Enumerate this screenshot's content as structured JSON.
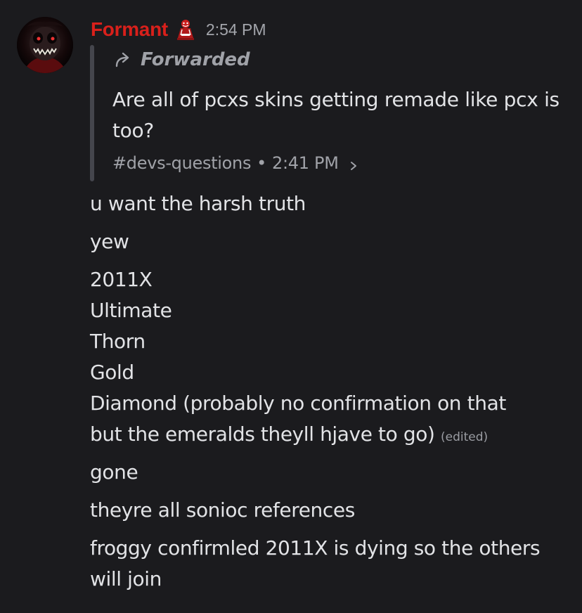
{
  "message": {
    "author": "Formant",
    "timestamp": "2:54 PM",
    "forwarded": {
      "label": "Forwarded",
      "text": "Are all of pcxs skins getting remade like pcx is too?",
      "channel": "#devs-questions",
      "separator": "•",
      "time": "2:41 PM"
    }
  },
  "messages": [
    "u want the harsh truth",
    "yew",
    "2011X",
    "Ultimate",
    "Thorn",
    "Gold",
    "Diamond (probably no confirmation on that",
    "but the emeralds theyll hjave to go)",
    "gone",
    "theyre all sonioc references",
    "froggy confirmled 2011X is dying so the others",
    "will join"
  ],
  "edited_label": "(edited)",
  "colors": {
    "background": "#1b1b1e",
    "username": "#d9201b",
    "text": "#e2e3e6",
    "muted": "#a0a2a8",
    "forward_bar": "#45464d"
  },
  "icons": {
    "role": "red-creepy-figure-icon",
    "forward": "forward-arrow-icon",
    "jump": "chevron-right-icon"
  }
}
